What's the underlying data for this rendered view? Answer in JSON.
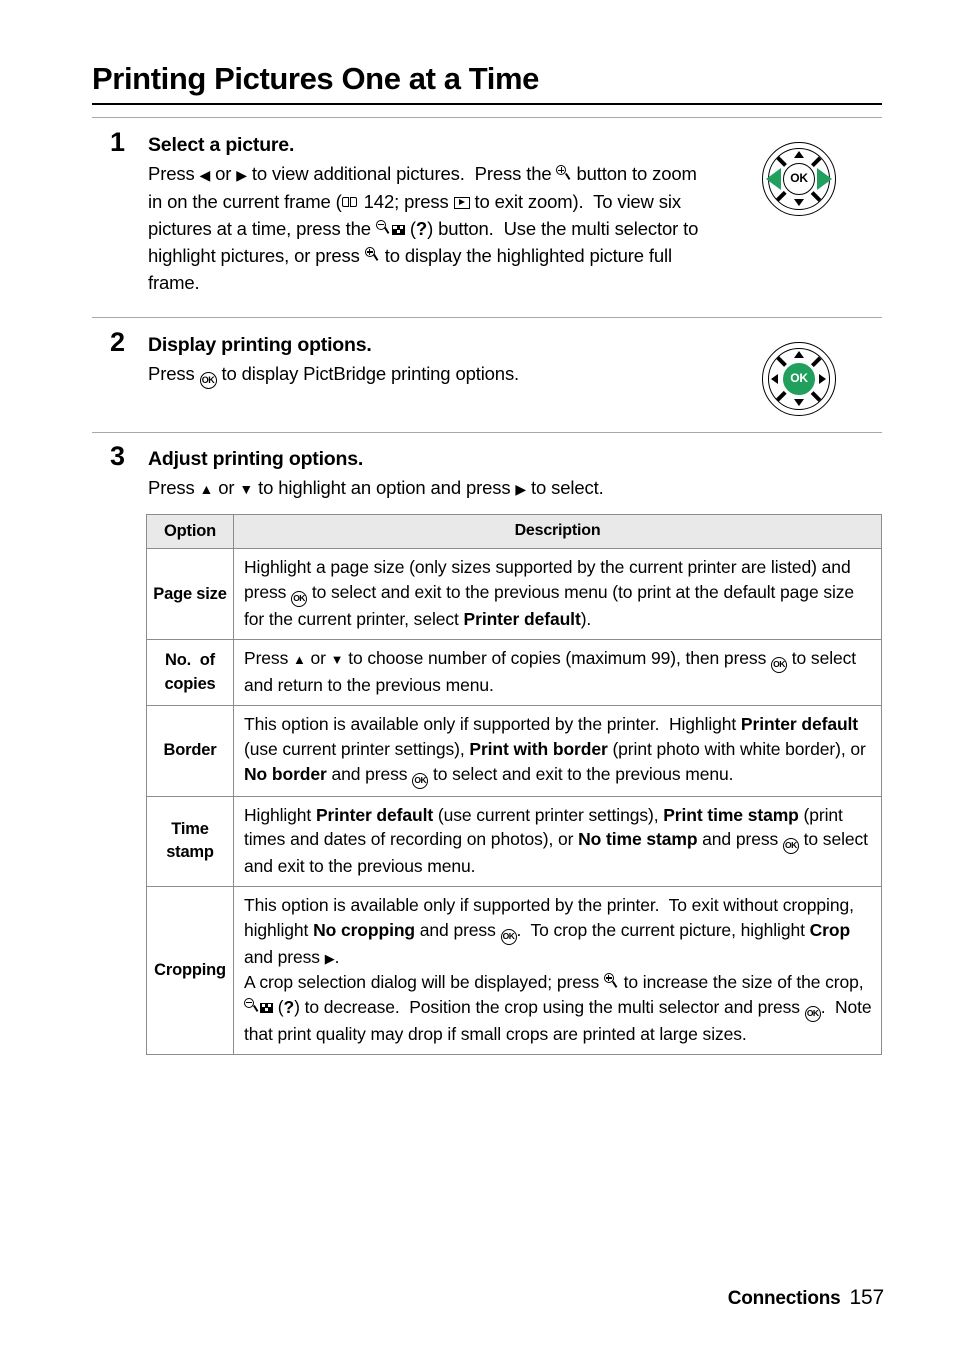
{
  "document": {
    "title": "Printing Pictures One at a Time",
    "footer": {
      "chapter": "Connections",
      "page_number": "157"
    }
  },
  "steps": [
    {
      "number": "1",
      "heading": "Select a picture.",
      "text_parts": [
        "Press ",
        "[left]",
        " or ",
        "[right]",
        " to view additional pictures.  Press the ",
        "[zoom-in]",
        " button to zoom in on the current frame (",
        "[book]",
        " 142; press ",
        "[playback]",
        " to exit zoom).  To view six pictures at a time, press the ",
        "[zoom-out]",
        "[thumbnail]",
        " (",
        "?",
        ") button.  Use the multi selector to highlight pictures, or press ",
        "[zoom-in]",
        " to display the highlighted picture full frame."
      ],
      "text_plain": "Press ◀ or ▶ to view additional pictures.  Press the zoom-in button to zoom in on the current frame (142; press playback to exit zoom).  To view six pictures at a time, press the zoom-out thumbnail (?) button.  Use the multi selector to highlight pictures, or press zoom-in to display the highlighted picture full frame.",
      "page_ref": "142",
      "diagram": {
        "name": "multi-selector-left-right",
        "highlight": "left-right",
        "center_label": "OK"
      }
    },
    {
      "number": "2",
      "heading": "Display printing options.",
      "text_plain": "Press OK to display PictBridge printing options.",
      "diagram": {
        "name": "multi-selector-ok",
        "highlight": "center",
        "center_label": "OK"
      }
    },
    {
      "number": "3",
      "heading": "Adjust printing options.",
      "text_plain": "Press ▲ or ▼ to highlight an option and press ▶ to select."
    }
  ],
  "table": {
    "headers": [
      "Option",
      "Description"
    ],
    "rows": [
      {
        "option": "Page size",
        "description": "Highlight a page size (only sizes supported by the current printer are listed) and press OK to select and exit to the previous menu (to print at the default page size for the current printer, select Printer default)."
      },
      {
        "option": "No.  of copies",
        "description": "Press ▲ or ▼ to choose number of copies (maximum 99), then press OK to select and return to the previous menu."
      },
      {
        "option": "Border",
        "description": "This option is available only if supported by the printer.  Highlight Printer default (use current printer settings), Print with border (print photo with white border), or No border and press OK to select and exit to the previous menu."
      },
      {
        "option": "Time stamp",
        "description": "Highlight Printer default (use current printer settings), Print time stamp (print times and dates of recording on photos), or No time stamp and press OK to select and exit to the previous menu."
      },
      {
        "option": "Cropping",
        "description": "This option is available only if supported by the printer.  To exit without cropping, highlight No cropping and press OK.  To crop the current picture, highlight Crop and press ▶. A crop selection dialog will be displayed; press zoom-in to increase the size of the crop, zoom-out (?) to decrease.  Position the crop using the multi selector and press OK.  Note that print quality may drop if small crops are printed at large sizes."
      }
    ]
  },
  "colors": {
    "accent_green": "#20a05c",
    "header_gray": "#e9e9e9",
    "rule_gray": "#a8a8a8"
  }
}
